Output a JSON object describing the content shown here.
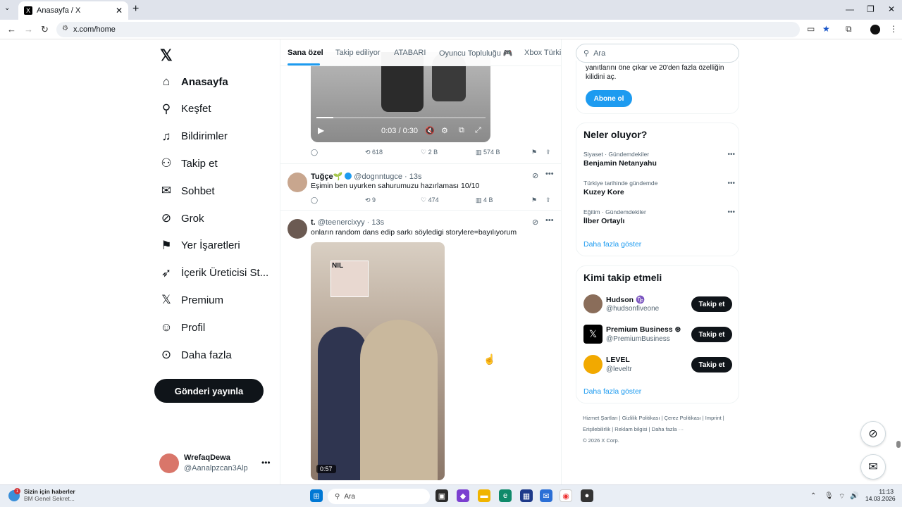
{
  "browser": {
    "tab_title": "Anasayfa / X",
    "tab_favicon": "X",
    "url": "x.com/home"
  },
  "nav": {
    "logo": "𝕏",
    "items": [
      {
        "label": "Anasayfa",
        "icon": "home-icon",
        "glyph": "⌂",
        "active": true
      },
      {
        "label": "Keşfet",
        "icon": "search-icon",
        "glyph": "⚲"
      },
      {
        "label": "Bildirimler",
        "icon": "bell-icon",
        "glyph": "♫"
      },
      {
        "label": "Takip et",
        "icon": "person-add-icon",
        "glyph": "⚇"
      },
      {
        "label": "Sohbet",
        "icon": "mail-icon",
        "glyph": "✉"
      },
      {
        "label": "Grok",
        "icon": "grok-icon",
        "glyph": "⊘"
      },
      {
        "label": "Yer İşaretleri",
        "icon": "bookmark-icon",
        "glyph": "⚑"
      },
      {
        "label": "İçerik Üreticisi St...",
        "icon": "rocket-icon",
        "glyph": "➶"
      },
      {
        "label": "Premium",
        "icon": "x-premium-icon",
        "glyph": "𝕏"
      },
      {
        "label": "Profil",
        "icon": "profile-icon",
        "glyph": "☺"
      },
      {
        "label": "Daha fazla",
        "icon": "more-circle-icon",
        "glyph": "⊙"
      }
    ],
    "post_button": "Gönderi yayınla",
    "account": {
      "name": "WrefaqDewa",
      "handle": "@Aanalpzcan3Alp"
    }
  },
  "timeline": {
    "tabs": [
      "Sana özel",
      "Takip ediliyor",
      "ATABARI",
      "Oyuncu Topluluğu 🎮",
      "Xbox Türkiy"
    ],
    "video1": {
      "time": "0:03 / 0:30",
      "progress": 0.1
    },
    "post0_actions": {
      "replies": "",
      "reposts": "618",
      "likes": "2 B",
      "views": "574 B"
    },
    "posts": [
      {
        "name": "Tuğçe🌱",
        "handle": "@dognntugce",
        "time": "13s",
        "text": "Eşimin ben uyurken sahurumuzu hazırlaması 10/10",
        "reposts": "9",
        "likes": "474",
        "views": "4 B"
      },
      {
        "name": "t.",
        "handle": "@teenercixyy",
        "time": "13s",
        "text": "onların random dans edip sarkı söyledigi storylere=bayılıyorum",
        "video_logo": "NIL",
        "video_duration": "0:57"
      }
    ]
  },
  "right": {
    "search_placeholder": "Ara",
    "premium_text": "yanıtlarını öne çıkar ve 20'den fazla özelliğin kilidini aç.",
    "premium_button": "Abone ol",
    "trends_title": "Neler oluyor?",
    "trends": [
      {
        "category": "Siyaset · Gündemdekiler",
        "name": "Benjamin Netanyahu"
      },
      {
        "category": "Türkiye tarihinde gündemde",
        "name": "Kuzey Kore"
      },
      {
        "category": "Eğitim · Gündemdekiler",
        "name": "İlber Ortaylı"
      }
    ],
    "show_more": "Daha fazla göster",
    "who_title": "Kimi takip etmeli",
    "who": [
      {
        "name": "Hudson ♑",
        "handle": "@hudsonfiveone",
        "color": "#8a6d5a"
      },
      {
        "name": "Premium Business ⊛",
        "handle": "@PremiumBusiness",
        "color": "#000000"
      },
      {
        "name": "LEVEL",
        "handle": "@leveltr",
        "color": "#f2a900"
      }
    ],
    "follow_button": "Takip et",
    "footer": "Hizmet Şartları  |  Gizlilik Politikası  |  Çerez Politikası  |  Imprint  |  Erişilebilirlik  |  Reklam bilgisi  |  Daha fazla ···",
    "copyright": "© 2026 X Corp."
  },
  "taskbar": {
    "news_title": "Sizin için haberler",
    "news_sub": "BM Genel Sekret...",
    "news_badge": "1",
    "search": "Ara",
    "time": "11:13",
    "date": "14.03.2026"
  }
}
